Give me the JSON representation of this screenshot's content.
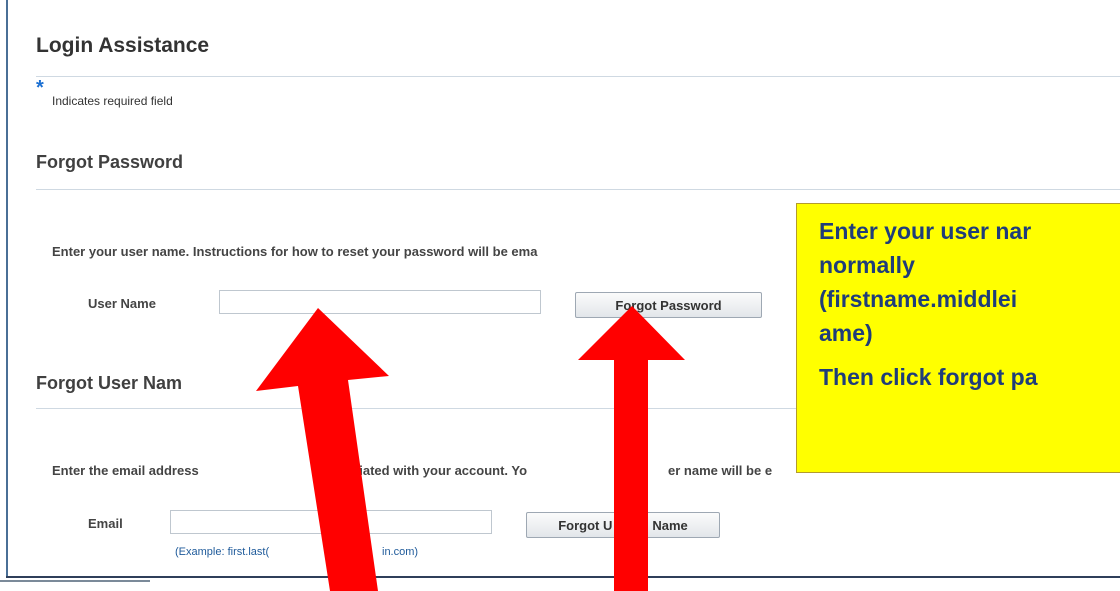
{
  "page": {
    "title": "Login Assistance"
  },
  "required_note": {
    "marker": "*",
    "text": "Indicates required field"
  },
  "forgot_password": {
    "title": "Forgot Password",
    "instruction": "Enter your user name. Instructions for how to reset your password will be ema",
    "field_label": "User Name",
    "field_value": "",
    "button_label": "Forgot Password"
  },
  "forgot_username": {
    "title": "Forgot User Nam",
    "instruction_part1": "Enter the email address ",
    "instruction_part2": "ciated with your account. Yo",
    "instruction_part3": "er name will be e",
    "field_label": "Email",
    "field_value": "",
    "button_label_part1": "Forgot U",
    "button_label_part2": "Name",
    "example_part1": "(Example: first.last(",
    "example_part2": "in.com)"
  },
  "callout": {
    "line1": "Enter your user nar",
    "line2": "normally",
    "line3": "(firstname.middlei",
    "line4": "ame)",
    "line5": "Then click forgot pa"
  },
  "colors": {
    "callout_bg": "#ffff00",
    "callout_text": "#1f3d7a",
    "arrow": "#ff0000",
    "required": "#1b6fd2"
  }
}
